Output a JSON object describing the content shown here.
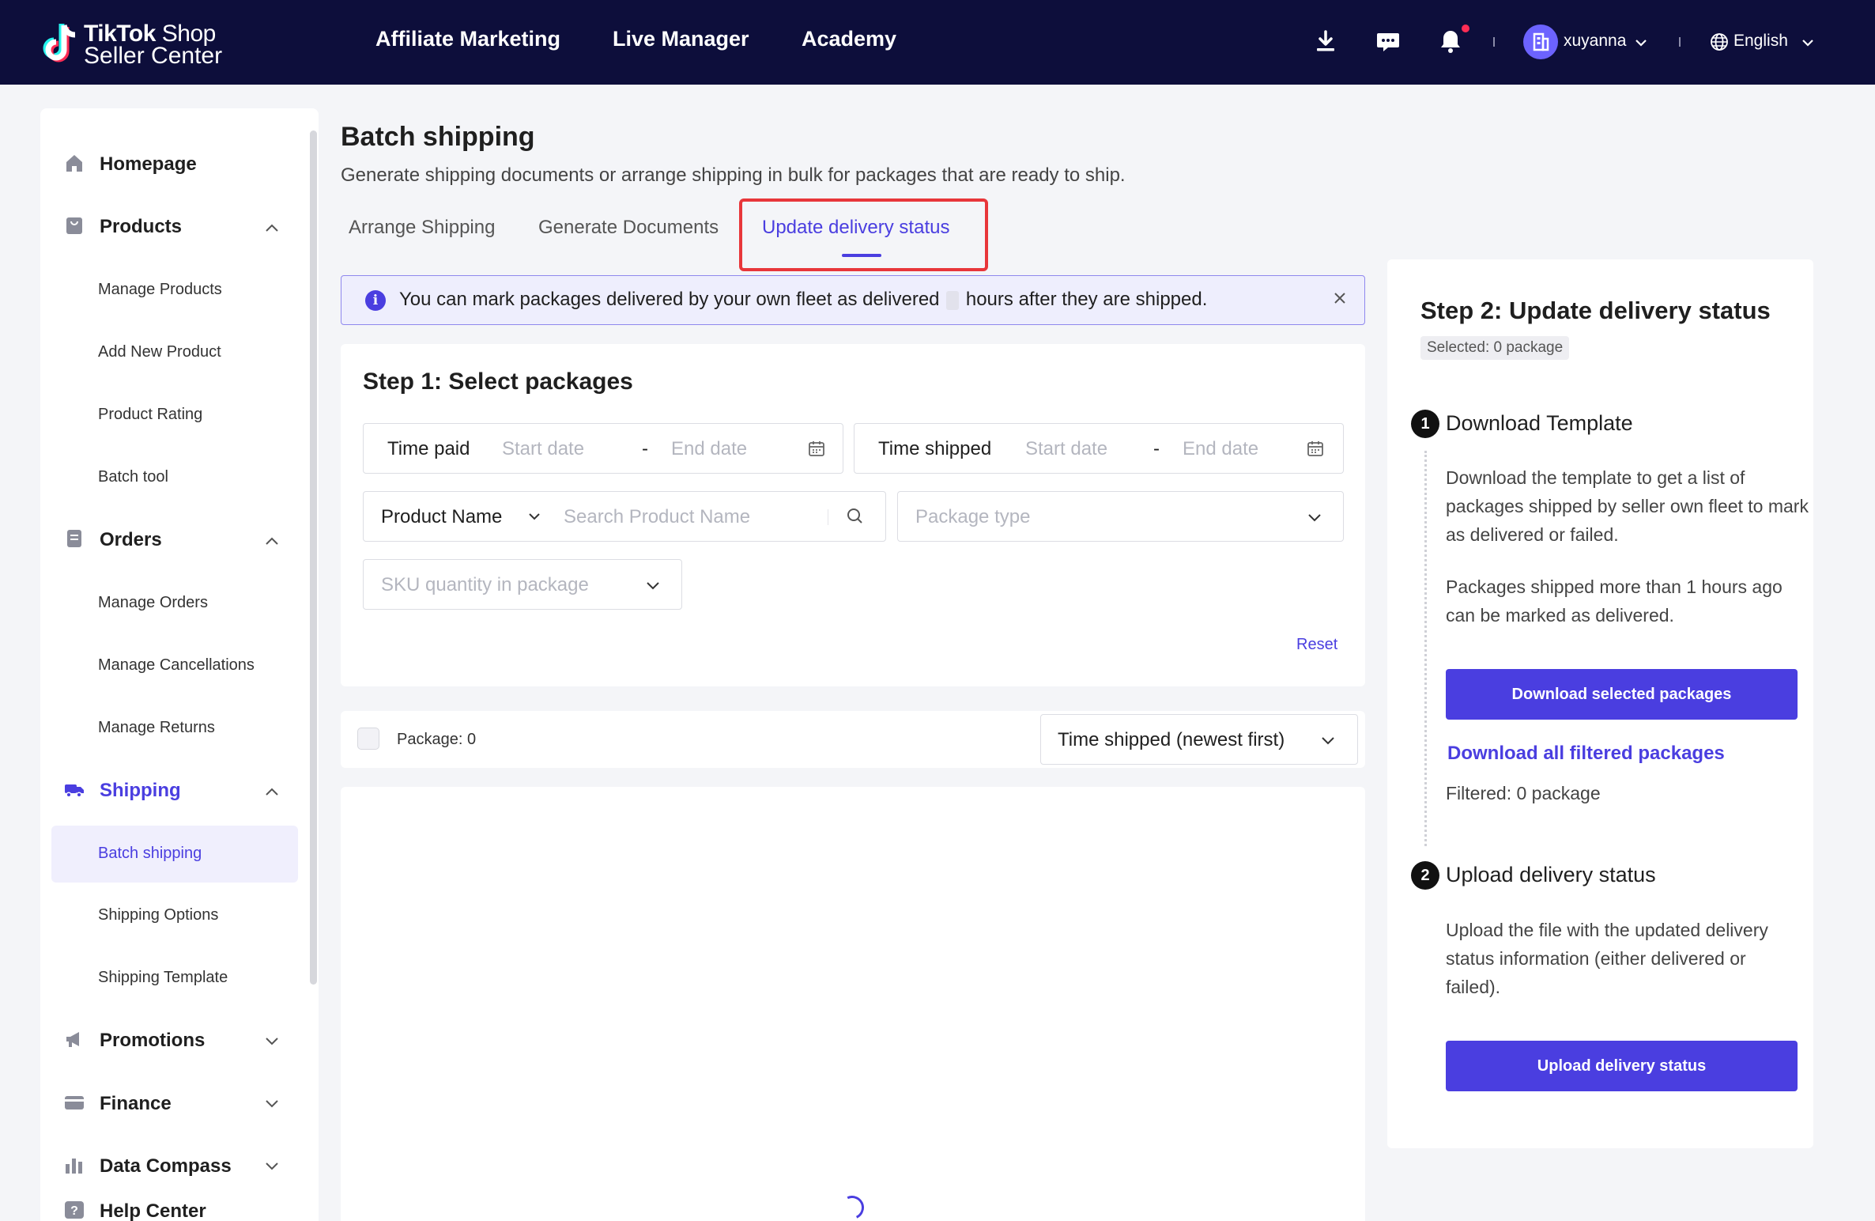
{
  "header": {
    "logo_line1_bold": "TikTok",
    "logo_line1_light": "Shop",
    "logo_line2": "Seller Center",
    "nav": [
      "Affiliate Marketing",
      "Live Manager",
      "Academy"
    ],
    "user": "xuyanna",
    "language": "English",
    "icons": [
      "download-icon",
      "message-icon",
      "bell-icon",
      "avatar-icon",
      "globe-icon"
    ]
  },
  "sidebar": {
    "groups": {
      "homepage": "Homepage",
      "products": "Products",
      "orders": "Orders",
      "shipping": "Shipping",
      "promotions": "Promotions",
      "finance": "Finance",
      "data_compass": "Data Compass",
      "help_center": "Help Center"
    },
    "products_items": [
      "Manage Products",
      "Add New Product",
      "Product Rating",
      "Batch tool"
    ],
    "orders_items": [
      "Manage Orders",
      "Manage Cancellations",
      "Manage Returns"
    ],
    "shipping_items": [
      "Batch shipping",
      "Shipping Options",
      "Shipping Template"
    ],
    "active_item": "Batch shipping"
  },
  "page": {
    "title": "Batch shipping",
    "subtitle": "Generate shipping documents or arrange shipping in bulk for packages that are ready to ship.",
    "tabs": [
      "Arrange Shipping",
      "Generate Documents",
      "Update delivery status"
    ],
    "active_tab": "Update delivery status"
  },
  "banner": {
    "text_before": "You can mark packages delivered by your own fleet as delivered",
    "text_after": "hours after they are shipped."
  },
  "step1": {
    "title": "Step 1: Select packages",
    "time_paid": {
      "label": "Time paid",
      "start": "Start date",
      "end": "End date"
    },
    "time_shipped": {
      "label": "Time shipped",
      "start": "Start date",
      "end": "End date"
    },
    "product_filter": {
      "label": "Product Name",
      "placeholder": "Search Product Name"
    },
    "package_type": {
      "placeholder": "Package type"
    },
    "sku_quantity": {
      "placeholder": "SKU quantity in package"
    },
    "reset": "Reset"
  },
  "list": {
    "package_count": "Package: 0",
    "sort": "Time shipped (newest first)"
  },
  "step2": {
    "title": "Step 2: Update delivery status",
    "selected": "Selected: 0 package",
    "s1_num": "1",
    "s1_title": "Download Template",
    "s1_desc1": "Download the template to get a list of packages shipped by seller own fleet to mark as delivered or failed.",
    "s1_desc2": "Packages shipped more than 1 hours ago can be marked as delivered.",
    "download_selected": "Download selected packages",
    "download_all": "Download all filtered packages",
    "filtered": "Filtered: 0 package",
    "s2_num": "2",
    "s2_title": "Upload delivery status",
    "s2_desc": "Upload the file with the updated delivery status information (either delivered or failed).",
    "upload": "Upload delivery status"
  },
  "colors": {
    "topbar": "#0d0e3b",
    "accent": "#4a3ee0",
    "highlight": "#e8363a"
  }
}
